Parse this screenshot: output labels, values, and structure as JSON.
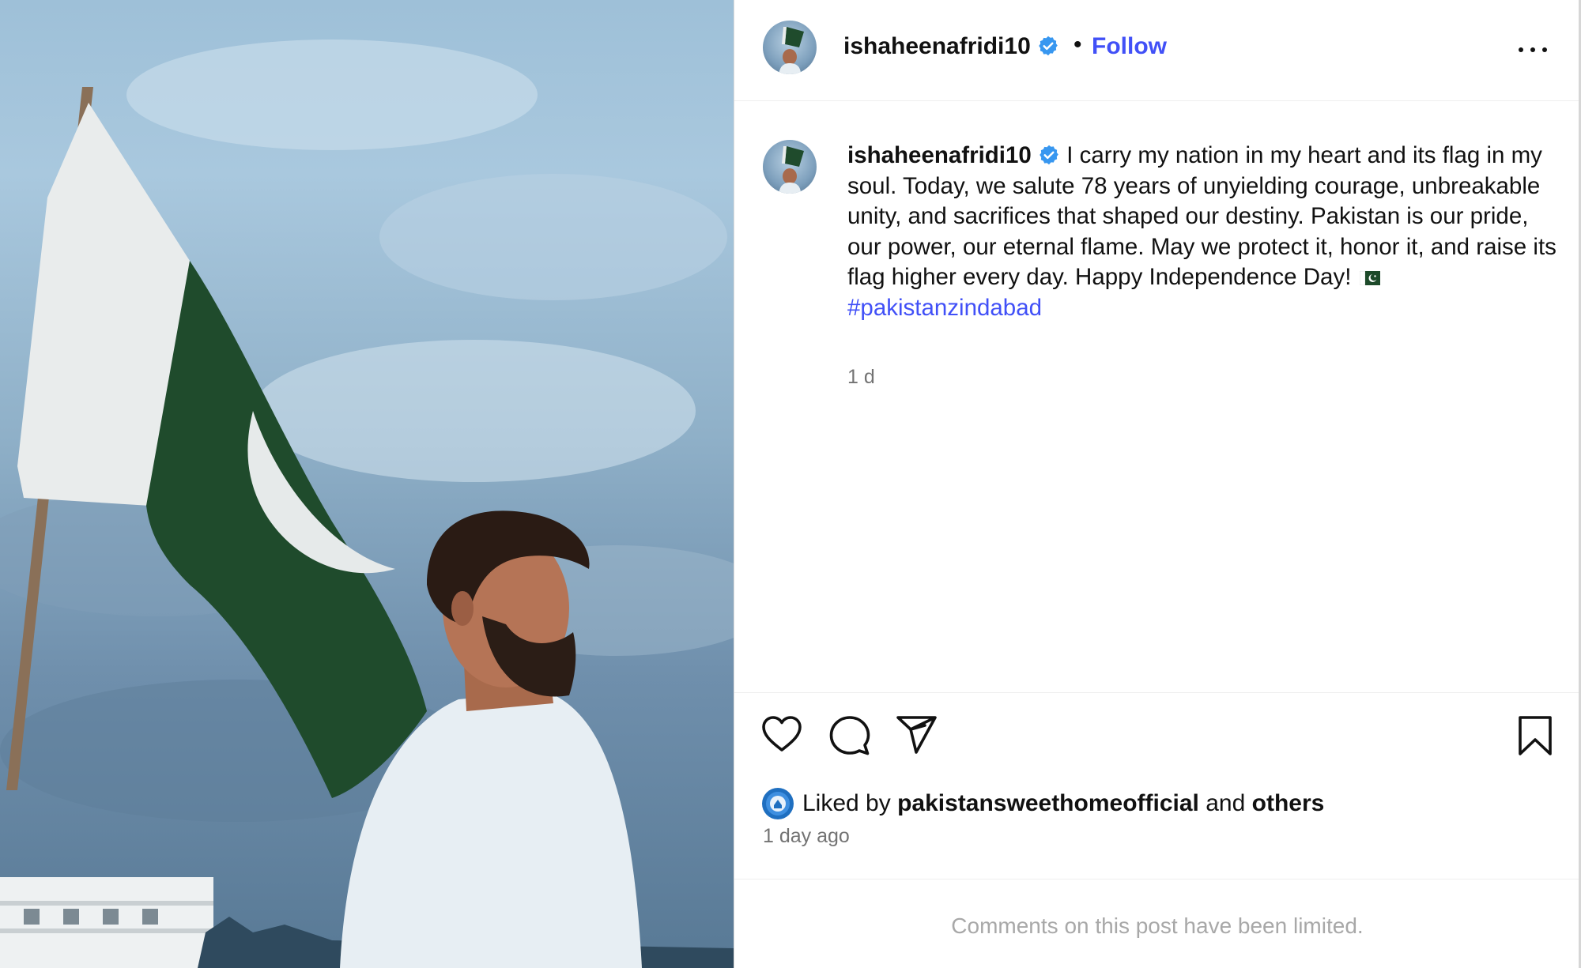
{
  "header": {
    "username": "ishaheenafridi10",
    "separator": "•",
    "follow_label": "Follow"
  },
  "post": {
    "caption_username": "ishaheenafridi10",
    "caption_text": "I carry my nation in my heart and its flag in my soul. Today, we salute 78 years of unyielding courage, unbreakable unity, and sacrifices that shaped our destiny. Pakistan is our pride, our power, our eternal flame. May we protect it, honor it, and raise its flag higher every day. Happy Independence Day!",
    "hashtag": "#pakistanzindabad",
    "caption_time": "1 d"
  },
  "engagement": {
    "liked_prefix": "Liked by",
    "liked_by_user": "pakistansweethomeofficial",
    "liked_and": "and",
    "liked_others": "others",
    "time_ago": "1 day ago"
  },
  "comments": {
    "limited_text": "Comments on this post have been limited."
  },
  "icons": [
    "verified-badge-icon",
    "more-options-icon",
    "heart-icon",
    "comment-icon",
    "share-icon",
    "bookmark-icon",
    "pakistan-flag-icon"
  ],
  "colors": {
    "accent": "#4150f7",
    "verified": "#3897f0",
    "muted": "#737373",
    "flag_green": "#1d4a2a"
  }
}
